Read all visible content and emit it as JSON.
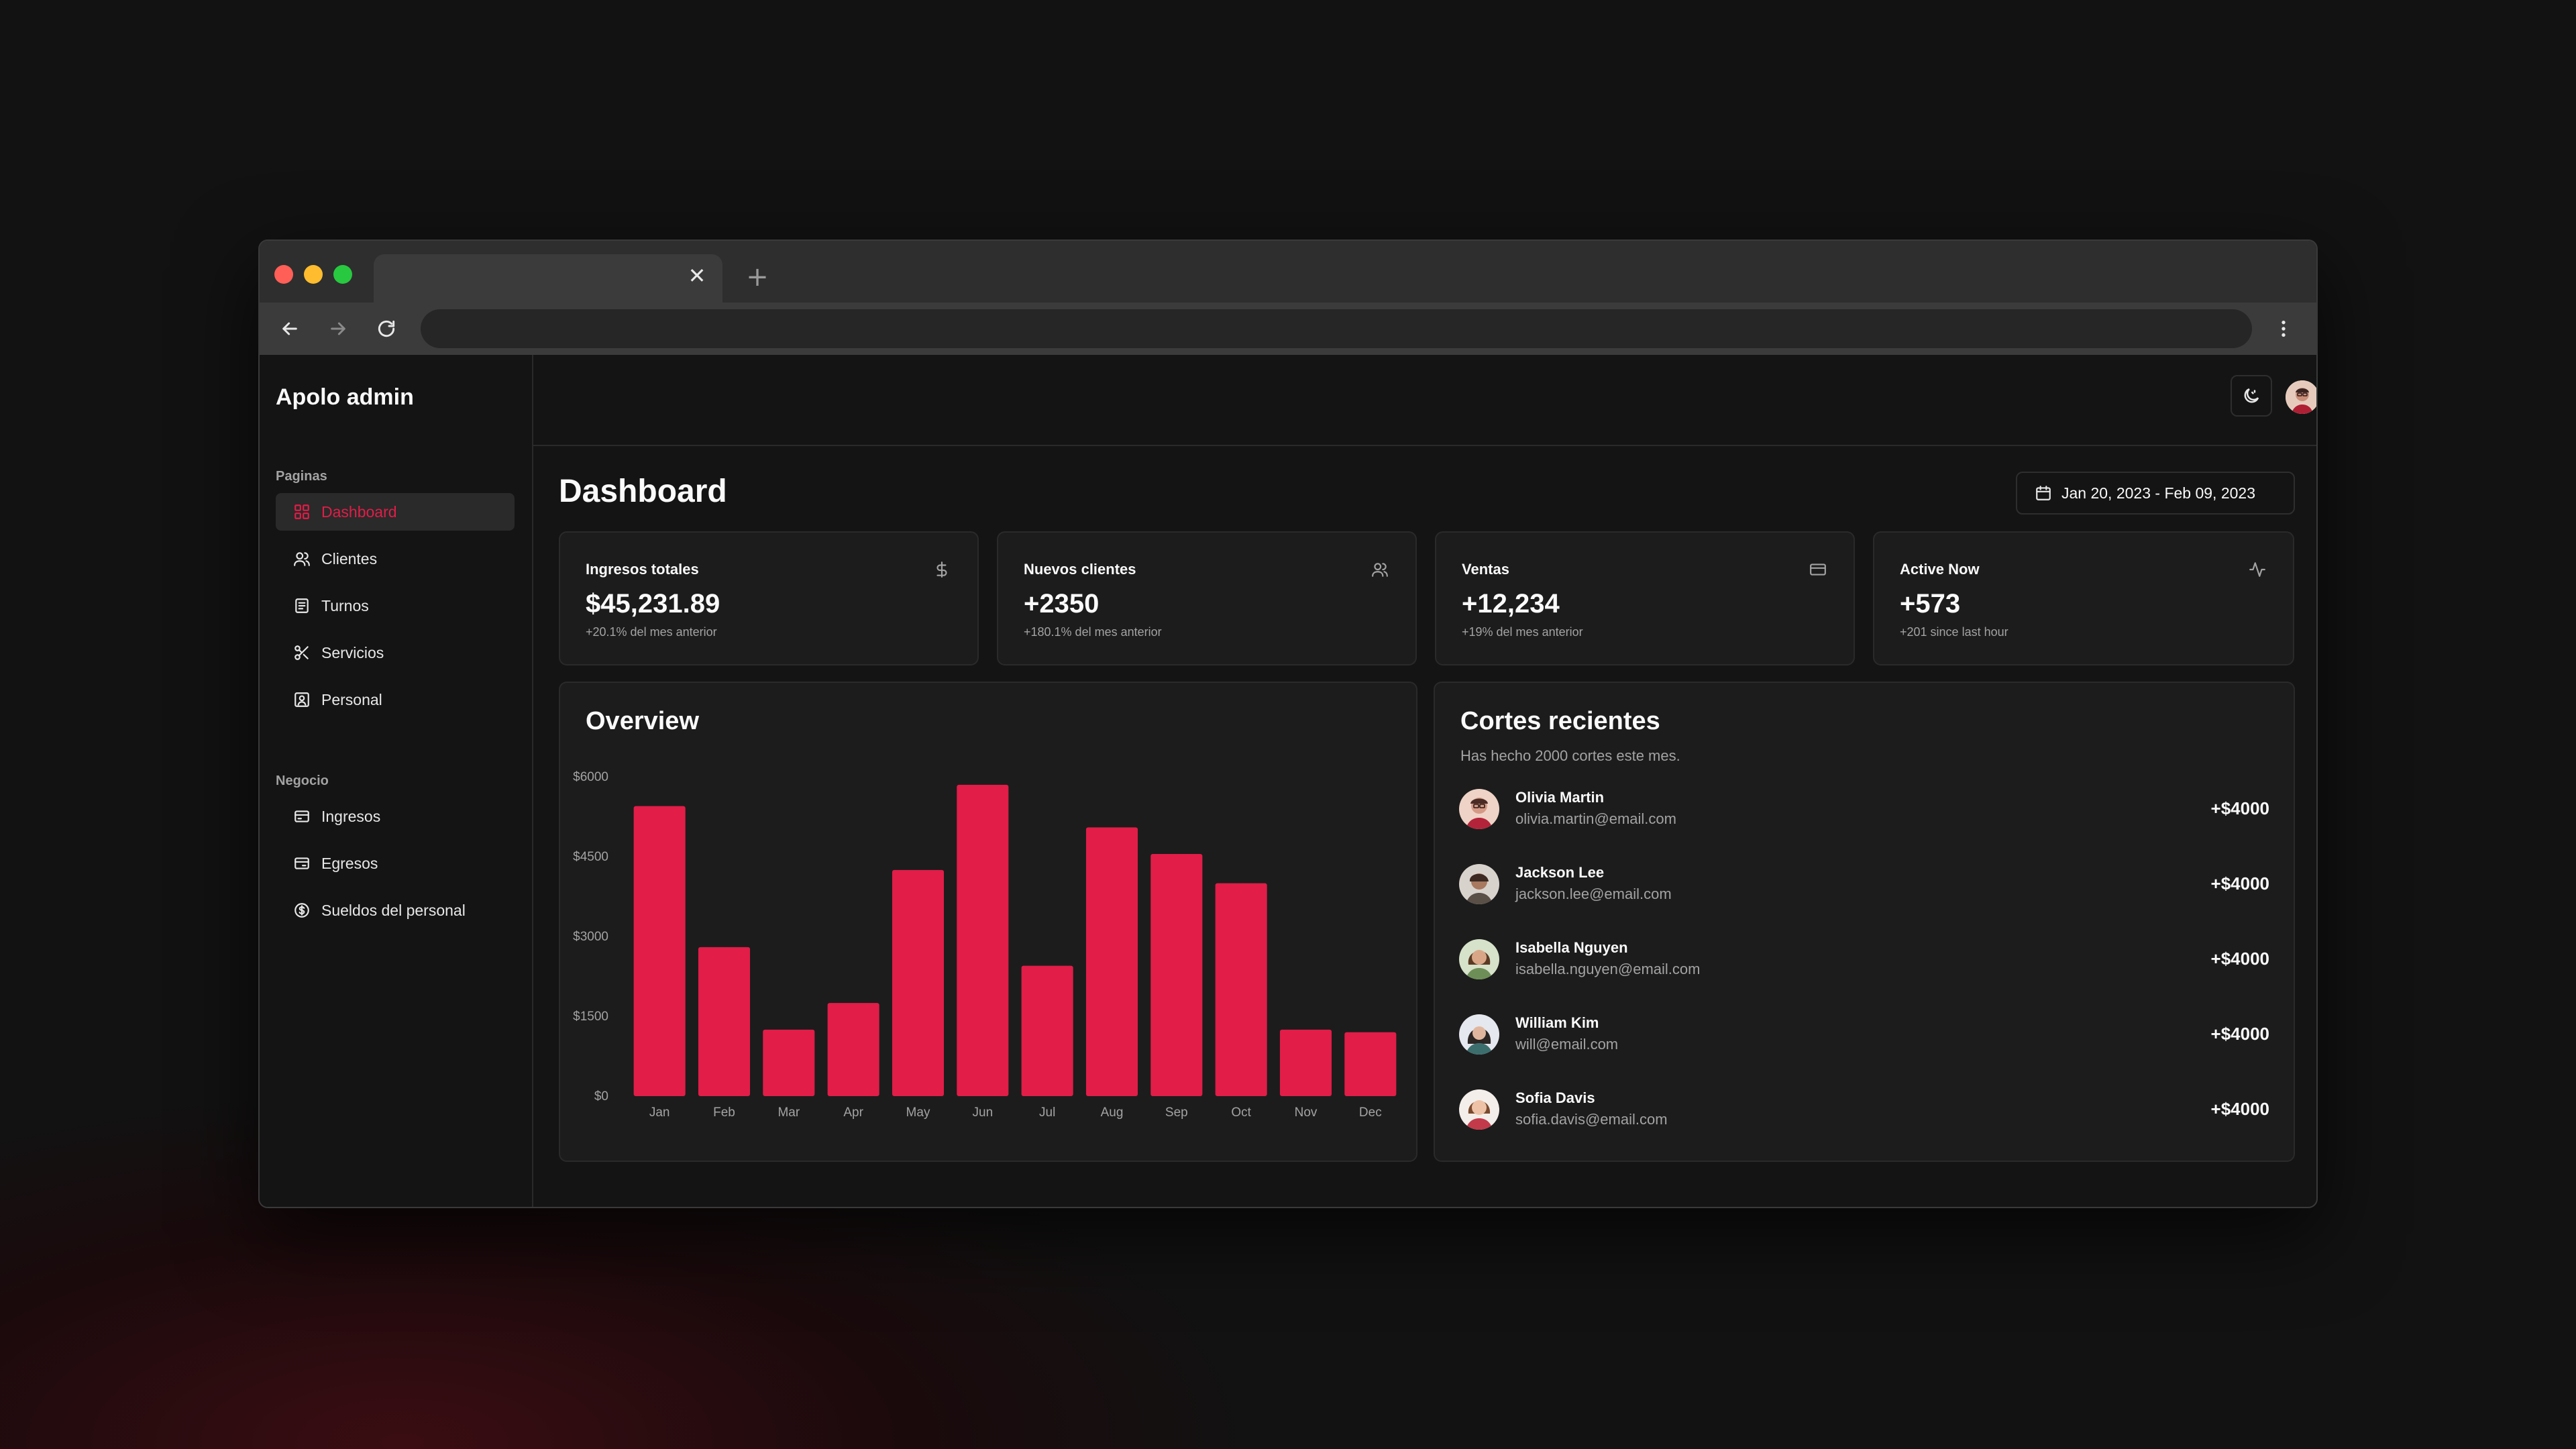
{
  "browser": {
    "tab_title": "",
    "address": "",
    "tab_close_glyph": "✕",
    "new_tab_glyph": "+"
  },
  "sidebar": {
    "brand": "Apolo admin",
    "groups": [
      {
        "label": "Paginas",
        "items": [
          {
            "label": "Dashboard",
            "icon": "dashboard-icon",
            "active": true
          },
          {
            "label": "Clientes",
            "icon": "users-icon"
          },
          {
            "label": "Turnos",
            "icon": "calendar-list-icon"
          },
          {
            "label": "Servicios",
            "icon": "scissors-icon"
          },
          {
            "label": "Personal",
            "icon": "id-badge-icon"
          }
        ]
      },
      {
        "label": "Negocio",
        "items": [
          {
            "label": "Ingresos",
            "icon": "wallet-in-icon"
          },
          {
            "label": "Egresos",
            "icon": "wallet-out-icon"
          },
          {
            "label": "Sueldos del personal",
            "icon": "dollar-circle-icon"
          }
        ]
      }
    ]
  },
  "header": {
    "title": "Dashboard",
    "date_range": "Jan 20, 2023 - Feb 09, 2023"
  },
  "stats": [
    {
      "title": "Ingresos totales",
      "value": "$45,231.89",
      "sub": "+20.1% del mes anterior",
      "icon": "dollar-icon"
    },
    {
      "title": "Nuevos clientes",
      "value": "+2350",
      "sub": "+180.1% del mes anterior",
      "icon": "users-icon"
    },
    {
      "title": "Ventas",
      "value": "+12,234",
      "sub": "+19% del mes anterior",
      "icon": "credit-card-icon"
    },
    {
      "title": "Active Now",
      "value": "+573",
      "sub": "+201 since last hour",
      "icon": "activity-icon"
    }
  ],
  "overview": {
    "title": "Overview"
  },
  "chart_data": {
    "type": "bar",
    "title": "Overview",
    "categories": [
      "Jan",
      "Feb",
      "Mar",
      "Apr",
      "May",
      "Jun",
      "Jul",
      "Aug",
      "Sep",
      "Oct",
      "Nov",
      "Dec"
    ],
    "values": [
      5450,
      2800,
      1250,
      1750,
      4250,
      5850,
      2450,
      5050,
      4550,
      4000,
      1250,
      1200
    ],
    "ylim": [
      0,
      6000
    ],
    "yticks": [
      0,
      1500,
      3000,
      4500,
      6000
    ],
    "ytick_labels": [
      "$0",
      "$1500",
      "$3000",
      "$4500",
      "$6000"
    ],
    "xlabel": "",
    "ylabel": "",
    "bar_color": "#e11d48",
    "grid": false
  },
  "recent": {
    "title": "Cortes recientes",
    "description": "Has hecho 2000 cortes este mes.",
    "items": [
      {
        "name": "Olivia Martin",
        "email": "olivia.martin@email.com",
        "amount": "+$4000"
      },
      {
        "name": "Jackson Lee",
        "email": "jackson.lee@email.com",
        "amount": "+$4000"
      },
      {
        "name": "Isabella Nguyen",
        "email": "isabella.nguyen@email.com",
        "amount": "+$4000"
      },
      {
        "name": "William Kim",
        "email": "will@email.com",
        "amount": "+$4000"
      },
      {
        "name": "Sofia Davis",
        "email": "sofia.davis@email.com",
        "amount": "+$4000"
      }
    ]
  },
  "colors": {
    "accent": "#e11d48",
    "card": "#1c1c1c",
    "border": "#2a2a2a",
    "muted": "#a3a3a3"
  }
}
